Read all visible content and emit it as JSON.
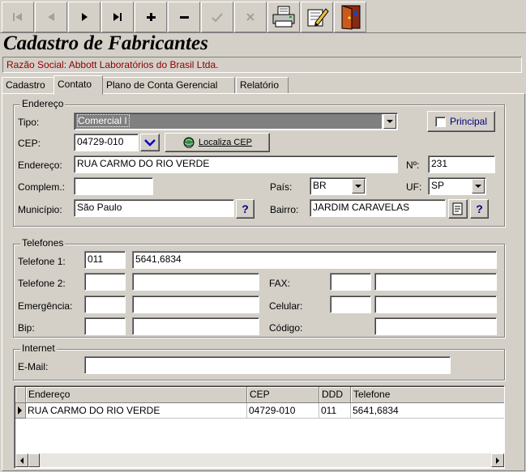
{
  "toolbar": {
    "buttons": [
      {
        "icon": "first-record-icon",
        "glyph": "|◀",
        "enabled": false
      },
      {
        "icon": "prior-record-icon",
        "glyph": "◀",
        "enabled": false
      },
      {
        "icon": "next-record-icon",
        "glyph": "▶",
        "enabled": true
      },
      {
        "icon": "last-record-icon",
        "glyph": "▶|",
        "enabled": true
      },
      {
        "icon": "insert-icon",
        "glyph": "+",
        "enabled": true
      },
      {
        "icon": "delete-icon",
        "glyph": "−",
        "enabled": true
      },
      {
        "icon": "post-icon",
        "glyph": "✓",
        "enabled": false
      },
      {
        "icon": "cancel-icon",
        "glyph": "✕",
        "enabled": false
      },
      {
        "icon": "printer-icon",
        "enabled": true
      },
      {
        "icon": "edit-document-icon",
        "enabled": true
      },
      {
        "icon": "exit-door-icon",
        "enabled": true
      }
    ]
  },
  "header": {
    "title": "Cadastro de Fabricantes",
    "razao_social": "Razão Social: Abbott Laboratórios do Brasil Ltda."
  },
  "tabs": [
    {
      "label": "Cadastro",
      "active": false
    },
    {
      "label": "Contato",
      "active": true
    },
    {
      "label": "Plano de Conta Gerencial",
      "active": false
    },
    {
      "label": "Relatório",
      "active": false
    }
  ],
  "endereco": {
    "group_title": "Endereço",
    "tipo_label": "Tipo:",
    "tipo_value": "Comercial I",
    "principal_label": "Principal",
    "cep_label": "CEP:",
    "cep_value": "04729-010",
    "localiza_cep_label": "Localiza CEP",
    "endereco_label": "Endereço:",
    "endereco_value": "RUA CARMO DO RIO VERDE",
    "numero_label": "Nº:",
    "numero_value": "231",
    "complemento_label": "Complem.:",
    "complemento_value": "",
    "pais_label": "País:",
    "pais_value": "BR",
    "uf_label": "UF:",
    "uf_value": "SP",
    "municipio_label": "Município:",
    "municipio_value": "São Paulo",
    "bairro_label": "Bairro:",
    "bairro_value": "JARDIM CARAVELAS",
    "help_glyph": "?"
  },
  "telefones": {
    "group_title": "Telefones",
    "telefone1_label": "Telefone 1:",
    "telefone1_ddd": "011",
    "telefone1_num": "5641,6834",
    "telefone2_label": "Telefone 2:",
    "fax_label": "FAX:",
    "emergencia_label": "Emergência:",
    "celular_label": "Celular:",
    "bip_label": "Bip:",
    "codigo_label": "Código:"
  },
  "internet": {
    "group_title": "Internet",
    "email_label": "E-Mail:",
    "email_value": ""
  },
  "grid": {
    "columns": [
      "Endereço",
      "CEP",
      "DDD",
      "Telefone"
    ],
    "rows": [
      [
        "RUA CARMO DO RIO VERDE",
        "04729-010",
        "011",
        "5641,6834"
      ]
    ]
  }
}
